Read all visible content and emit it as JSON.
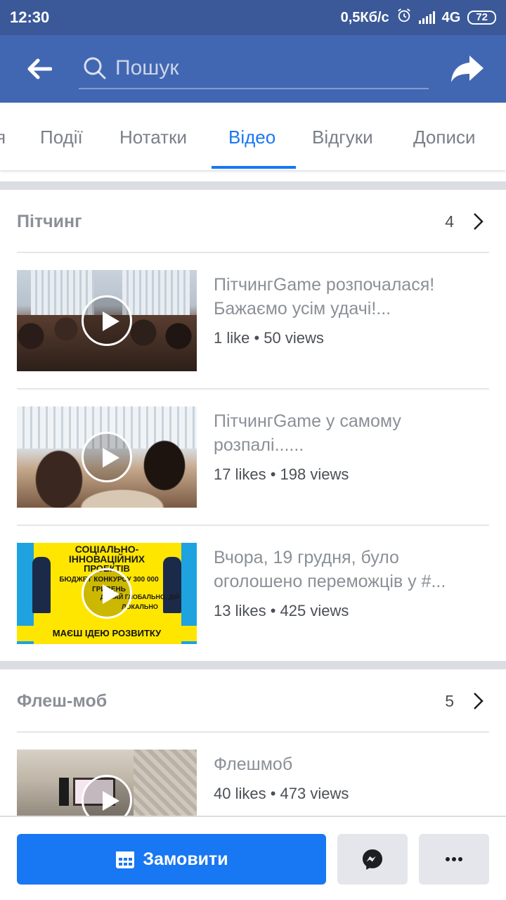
{
  "status_bar": {
    "time": "12:30",
    "net_speed": "0,5Кб/с",
    "network": "4G",
    "battery": "72"
  },
  "header": {
    "search_placeholder": "Пошук",
    "icons": [
      "back-arrow-icon",
      "search-icon",
      "share-icon"
    ]
  },
  "tabs": {
    "partial": "я",
    "items": [
      "Події",
      "Нотатки",
      "Відео",
      "Відгуки",
      "Дописи"
    ],
    "active": "Відео"
  },
  "sections": [
    {
      "title": "Пітчинг",
      "count": "4",
      "videos": [
        {
          "title": "ПітчингGame розпочалася! Бажаємо усім удачі!...",
          "meta": "1 like • 50 views"
        },
        {
          "title": "ПітчингGame у самому розпалі......",
          "meta": "17 likes • 198 views"
        },
        {
          "title": "Вчора, 19 грудня, було оголошено переможців у #...",
          "meta": "13 likes • 425 views",
          "thumb_text": {
            "line1": "СОЦІАЛЬНО-",
            "line2": "ІННОВАЦІЙНИХ",
            "line3": "ПРОЕКТІВ",
            "budget": "БЮДЖЕТ КОНКУРСУ 300 000 ГРИВЕНЬ",
            "slogan": "ДУМАЙ ГЛОБАЛЬНО, ДІЙ ЛОКАЛЬНО",
            "bottom": "МАЄШ ІДЕЮ РОЗВИТКУ УНІВЕРСИТЕТУ"
          }
        }
      ]
    },
    {
      "title": "Флеш-моб",
      "count": "5",
      "videos": [
        {
          "title": "Флешмоб",
          "meta": "40 likes • 473 views"
        }
      ]
    }
  ],
  "bottom_bar": {
    "order_label": "Замовити",
    "icons": [
      "calendar-icon",
      "messenger-icon",
      "more-icon"
    ]
  },
  "colors": {
    "status_bar": "#3b5998",
    "header": "#4267b2",
    "accent": "#1877f2",
    "muted_text": "#8b9097"
  }
}
